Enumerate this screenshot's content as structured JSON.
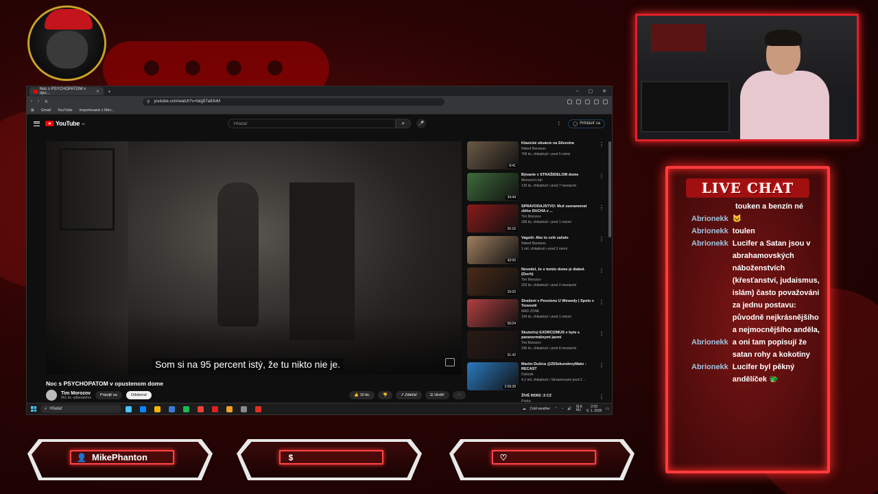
{
  "browser": {
    "tab_title": "Noc s PSYCHOPATOM v opu...",
    "url": "youtube.com/watch?v=fatg57a83oM",
    "bookmarks": [
      "Gmail",
      "YouTube",
      "Importované z Micr..."
    ]
  },
  "youtube": {
    "logo_text": "YouTube",
    "region": "SK",
    "search_placeholder": "Hľadať",
    "signin_label": "Prihlásiť sa",
    "subtitle": "Som si na 95 percent istý, že tu nikto nie je.",
    "video_title": "Noc s PSYCHOPATOM v opustenom dome",
    "channel_name": "Tim Morozov",
    "channel_subs": "661 tis. odberateľov",
    "join_label": "Pripojiť sa",
    "subscribe_label": "Odoberať",
    "likes_label": "10 tis.",
    "share_label": "Zdieľať",
    "save_label": "Uložiť"
  },
  "recommendations": [
    {
      "title": "Klasické situácie na Silvestra",
      "channel": "Naked Bananas",
      "meta": "709 tis. zhliadnutí • pred 5 rokmi",
      "duration": "8:41",
      "color": "#6b5a45"
    },
    {
      "title": "Bývanie v STRAŠIDELOM dome",
      "channel": "Morozov's fan",
      "meta": "139 tis. zhliadnutí • pred 7 mesiacmi",
      "duration": "34:44",
      "color": "#3e6b3a"
    },
    {
      "title": "SPRAVODAJSTVO: Muž zaznamenal zlého DUCHA v ...",
      "channel": "Tim Morozov",
      "meta": "268 tis. zhliadnutí • pred 1 rokom",
      "duration": "26:16",
      "color": "#8a1a1a"
    },
    {
      "title": "Vagoši: Ako to celé začalo",
      "channel": "Naked Bananas",
      "meta": "1 mil. zhliadnutí • pred 2 rokmi",
      "duration": "42:00",
      "color": "#a08060"
    },
    {
      "title": "Nevedel, že v tomto dome je diabol. (Duch)",
      "channel": "Tim Morozov",
      "meta": "229 tis. zhliadnutí • pred 2 mesiacmi",
      "duration": "29:20",
      "color": "#4a2a18"
    },
    {
      "title": "Strašení v Penzionu U Wewody | Spolu v Temnotě",
      "channel": "MAD ZONE",
      "meta": "194 tis. zhliadnutí • pred 1 rokom",
      "duration": "56:04",
      "color": "#b04040"
    },
    {
      "title": "Skutočný EXORCIZMUS v byte s paranormálnymi javmi",
      "channel": "Tim Morozov",
      "meta": "246 tis. zhliadnutí • pred 8 mesiacmi",
      "duration": "31:42",
      "color": "#2a1a14"
    },
    {
      "title": "Martin Dušica @25SekundovyMato - RECAST",
      "channel": "Dukicek",
      "meta": "4,1 mil. zhliadnutí • Streamované pred 2 ...",
      "duration": "2:09:28",
      "color": "#2a7ac0"
    }
  ],
  "next_item": {
    "title": "ŽIVÉ RDR2 :3 CZ",
    "channel": "Podcs"
  },
  "taskbar": {
    "search_placeholder": "Hľadať",
    "weather": "Cold weather",
    "lang": "SLK\nHU",
    "time": "2:03",
    "date": "9. 1. 2026",
    "icon_colors": [
      "#4cc2ff",
      "#0a84ff",
      "#f5b400",
      "#3a7bd5",
      "#1db954",
      "#ea4335",
      "#e02020",
      "#f0a020",
      "#8a8a8a",
      "#e03020"
    ]
  },
  "chat": {
    "title": "LIVE CHAT",
    "messages": [
      {
        "user": "",
        "text": "touken a benzín né"
      },
      {
        "user": "Abrionekk",
        "text": "🐱"
      },
      {
        "user": "Abrionekk",
        "text": "toulen"
      },
      {
        "user": "Abrionekk",
        "text": "Lucifer a Satan jsou v abrahamovských náboženstvích (křesťanství, judaismus, islám) často považováni za jednu postavu: původně nejkrásnějšího a nejmocnějšího anděla,"
      },
      {
        "user": "Abrionekk",
        "text": "a oni tam popisují že satan rohy a kokotiny"
      },
      {
        "user": "Abrionekk",
        "text": "Lucifer byl pěkný andělíček 🐲"
      }
    ]
  },
  "panels": {
    "username": "MikePhanton",
    "donation": "",
    "follow": ""
  }
}
